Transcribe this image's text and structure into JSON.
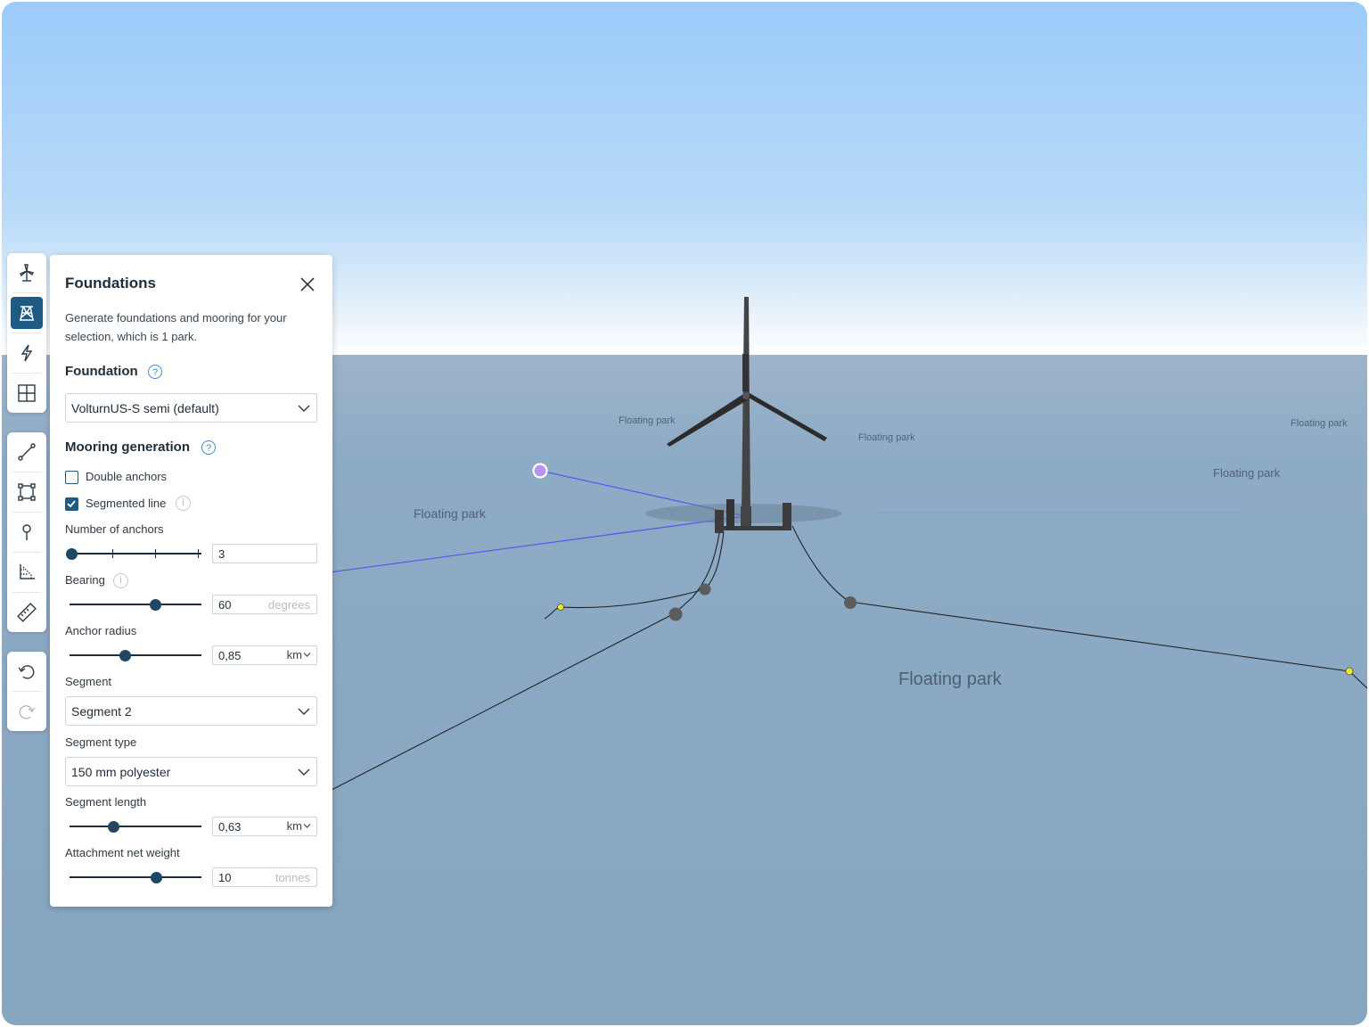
{
  "panel": {
    "title": "Foundations",
    "description": "Generate foundations and mooring for your selection, which is 1 park.",
    "foundation": {
      "label": "Foundation",
      "selected": "VolturnUS-S semi (default)"
    },
    "mooring": {
      "label": "Mooring generation",
      "double_anchors": {
        "label": "Double anchors",
        "checked": false
      },
      "segmented_line": {
        "label": "Segmented line",
        "checked": true
      },
      "number_of_anchors": {
        "label": "Number of anchors",
        "value": "3"
      },
      "bearing": {
        "label": "Bearing",
        "value": "60",
        "unit": "degrees",
        "slider_fraction": 0.65
      },
      "anchor_radius": {
        "label": "Anchor radius",
        "value": "0,85",
        "unit": "km",
        "slider_fraction": 0.4
      },
      "segment": {
        "label": "Segment",
        "selected": "Segment 2"
      },
      "segment_type": {
        "label": "Segment type",
        "selected": "150 mm polyester"
      },
      "segment_length": {
        "label": "Segment length",
        "value": "0,63",
        "unit": "km",
        "slider_fraction": 0.34
      },
      "attachment_net_weight": {
        "label": "Attachment net weight",
        "value": "10",
        "unit": "tonnes",
        "slider_fraction": 0.66
      }
    }
  },
  "scene": {
    "park_labels": [
      "Floating park",
      "Floating park",
      "Floating park",
      "Floating park",
      "Floating park",
      "Floating park"
    ]
  },
  "colors": {
    "accent": "#1e5b82",
    "sky_top": "#9ccbfa",
    "sea": "#89a9c4",
    "help": "#3f8bd8"
  },
  "toolbar": {
    "tools": [
      "turbine-icon",
      "foundation-icon",
      "lightning-icon",
      "grid-icon",
      "line-tool-icon",
      "polygon-tool-icon",
      "point-tool-icon",
      "axis-tool-icon",
      "ruler-icon",
      "undo-icon",
      "redo-icon"
    ]
  }
}
